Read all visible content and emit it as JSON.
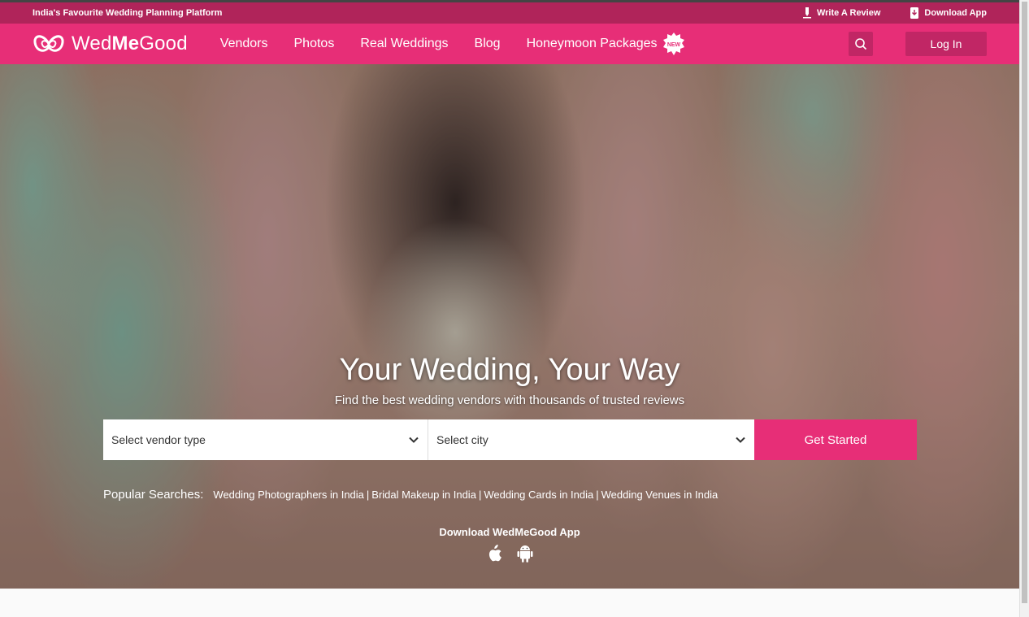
{
  "topbar": {
    "tagline": "India's Favourite Wedding Planning Platform",
    "write_review": "Write A Review",
    "download_app": "Download App"
  },
  "navbar": {
    "logo_prefix": "Wed",
    "logo_bold": "Me",
    "logo_suffix": "Good",
    "items": [
      "Vendors",
      "Photos",
      "Real Weddings",
      "Blog",
      "Honeymoon Packages"
    ],
    "new_badge": "NEW",
    "login": "Log In"
  },
  "hero": {
    "headline": "Your Wedding, Your Way",
    "subline": "Find the best wedding vendors with thousands of trusted reviews",
    "vendor_select": "Select vendor type",
    "city_select": "Select city",
    "cta": "Get Started",
    "popular_label": "Popular Searches:",
    "popular": [
      "Wedding Photographers in India",
      "Bridal Makeup in India",
      "Wedding Cards in India",
      "Wedding Venues in India"
    ],
    "app_title": "Download WedMeGood App"
  },
  "colors": {
    "brand": "#e72e77",
    "brand_dark": "#b0245a",
    "button_dark": "#c12665"
  },
  "icons": [
    "pen-icon",
    "phone-download-icon",
    "search-icon",
    "chevron-down-icon",
    "apple-icon",
    "android-icon",
    "logo-icon",
    "new-badge-icon"
  ]
}
